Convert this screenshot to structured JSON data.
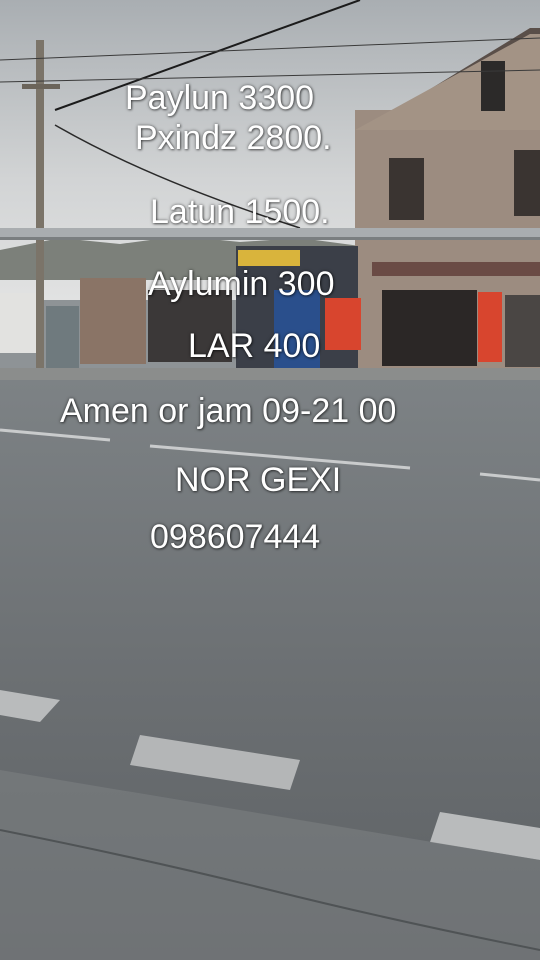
{
  "overlay": {
    "lines": {
      "paylun": "Paylun 3300",
      "pxindz": "Pxindz 2800.",
      "latun": "Latun 1500.",
      "aylumin": "Aylumin 300",
      "lar": "LAR 400",
      "hours": "Amen or jam 09-21 00",
      "location": "NOR GEXI",
      "phone": "098607444"
    }
  },
  "colors": {
    "overlay_text": "#ffffff",
    "sky": "#c9ccce",
    "road": "#6f7375",
    "building": "#9a8a7d",
    "shop_sign": "#d8452e"
  }
}
